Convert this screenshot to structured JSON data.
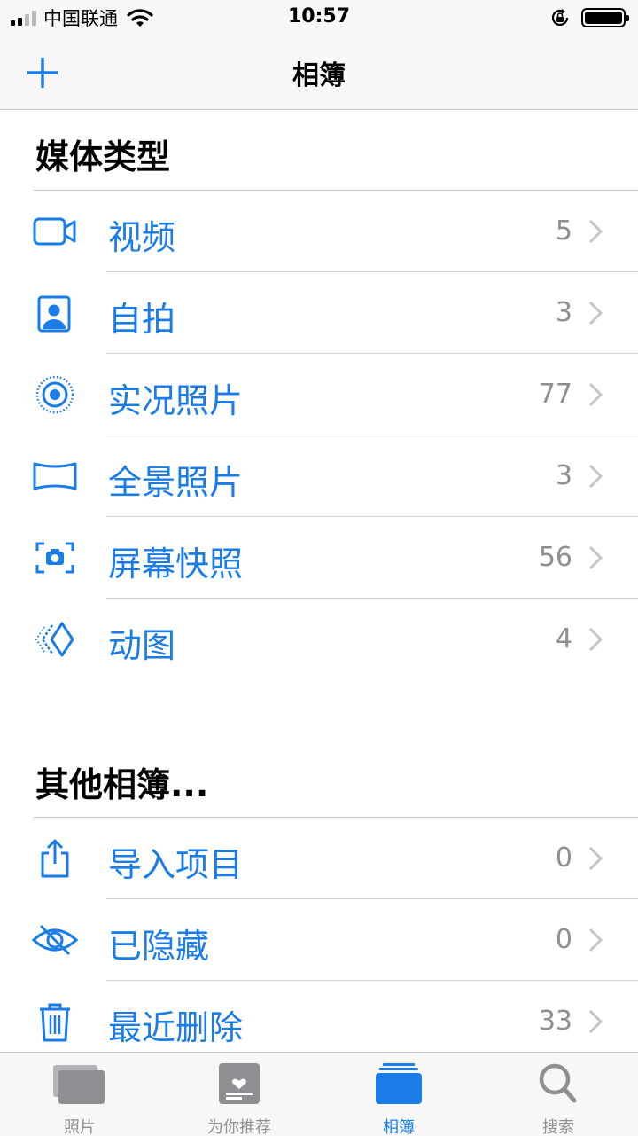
{
  "status_bar": {
    "carrier": "中国联通",
    "time": "10:57"
  },
  "nav": {
    "title": "相簿"
  },
  "sections": {
    "media_types": {
      "title": "媒体类型",
      "items": [
        {
          "label": "视频",
          "count": "5",
          "icon": "video-icon"
        },
        {
          "label": "自拍",
          "count": "3",
          "icon": "selfie-icon"
        },
        {
          "label": "实况照片",
          "count": "77",
          "icon": "live-photo-icon"
        },
        {
          "label": "全景照片",
          "count": "3",
          "icon": "panorama-icon"
        },
        {
          "label": "屏幕快照",
          "count": "56",
          "icon": "screenshot-icon"
        },
        {
          "label": "动图",
          "count": "4",
          "icon": "animated-icon"
        }
      ]
    },
    "other_albums": {
      "title": "其他相簿...",
      "items": [
        {
          "label": "导入项目",
          "count": "0",
          "icon": "import-icon"
        },
        {
          "label": "已隐藏",
          "count": "0",
          "icon": "hidden-eye-icon"
        },
        {
          "label": "最近删除",
          "count": "33",
          "icon": "trash-icon"
        }
      ]
    }
  },
  "tabs": [
    {
      "label": "照片",
      "icon": "photos-tab-icon",
      "active": false
    },
    {
      "label": "为你推荐",
      "icon": "for-you-tab-icon",
      "active": false
    },
    {
      "label": "相簿",
      "icon": "albums-tab-icon",
      "active": true
    },
    {
      "label": "搜索",
      "icon": "search-tab-icon",
      "active": false
    }
  ],
  "colors": {
    "accent": "#1a7ce8",
    "secondary_text": "#8e8e93",
    "bar_background": "#f7f7f7"
  }
}
